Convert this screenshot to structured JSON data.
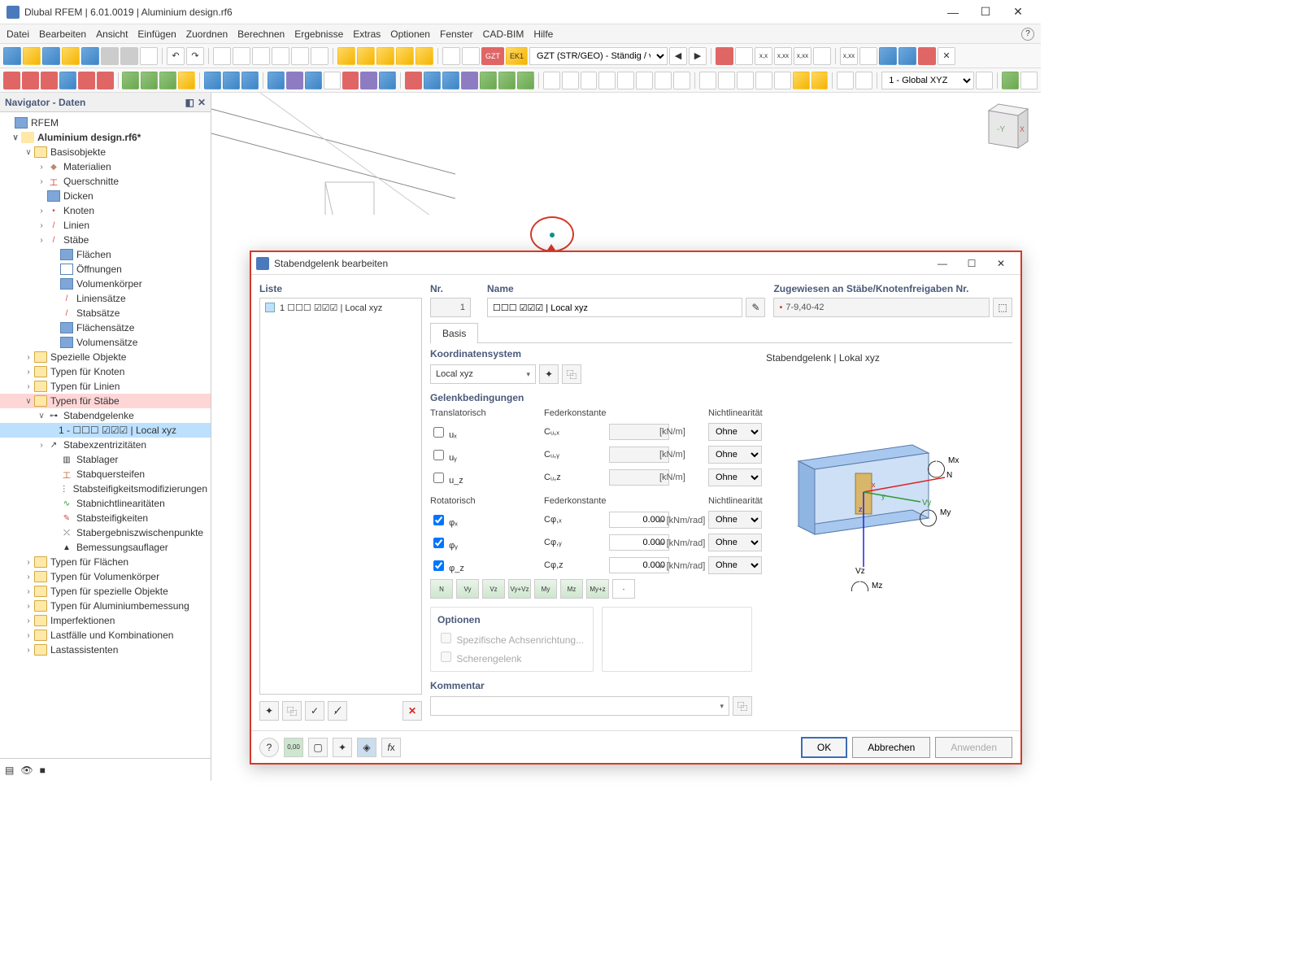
{
  "window": {
    "title": "Dlubal RFEM | 6.01.0019 | Aluminium design.rf6"
  },
  "menu": {
    "datei": "Datei",
    "bearbeiten": "Bearbeiten",
    "ansicht": "Ansicht",
    "einfuegen": "Einfügen",
    "zuordnen": "Zuordnen",
    "berechnen": "Berechnen",
    "ergebnisse": "Ergebnisse",
    "extras": "Extras",
    "optionen": "Optionen",
    "fenster": "Fenster",
    "cadbim": "CAD-BIM",
    "hilfe": "Hilfe"
  },
  "toolbar": {
    "gzt": "GZT",
    "ek1": "EK1",
    "combo": "GZT (STR/GEO) - Ständig / v...",
    "coord": "1 - Global XYZ"
  },
  "navigator": {
    "title": "Navigator - Daten",
    "root": "RFEM",
    "file": "Aluminium design.rf6*",
    "basis": "Basisobjekte",
    "items": {
      "materialien": "Materialien",
      "querschnitte": "Querschnitte",
      "dicken": "Dicken",
      "knoten": "Knoten",
      "linien": "Linien",
      "staebe": "Stäbe",
      "flaechen": "Flächen",
      "oeffnungen": "Öffnungen",
      "volumen": "Volumenkörper",
      "liniensaetze": "Liniensätze",
      "stabsaetze": "Stabsätze",
      "flaechensaetze": "Flächensätze",
      "volumensaetze": "Volumensätze"
    },
    "groups": {
      "spezielle": "Spezielle Objekte",
      "typKnoten": "Typen für Knoten",
      "typLinien": "Typen für Linien",
      "typStaebe": "Typen für Stäbe",
      "stabendgelenke": "Stabendgelenke",
      "item1": "1 - ☐☐☐ ☑☑☑ | Local xyz",
      "stabexz": "Stabexzentrizitäten",
      "stablager": "Stablager",
      "stabquer": "Stabquersteifen",
      "stabsteifmod": "Stabsteifigkeitsmodifizierungen",
      "stabnicht": "Stabnichtlinearitäten",
      "stabsteif": "Stabsteifigkeiten",
      "staberg": "Stabergebniszwischenpunkte",
      "bemessung": "Bemessungsauflager",
      "typFlaechen": "Typen für Flächen",
      "typVolumen": "Typen für Volumenkörper",
      "typSpez": "Typen für spezielle Objekte",
      "typAlu": "Typen für Aluminiumbemessung",
      "imperf": "Imperfektionen",
      "lastfaelle": "Lastfälle und Kombinationen",
      "lastass": "Lastassistenten"
    }
  },
  "dialog": {
    "title": "Stabendgelenk bearbeiten",
    "liste": "Liste",
    "listItem": "1 ☐☐☐ ☑☑☑ | Local xyz",
    "nr": "Nr.",
    "nrVal": "1",
    "name": "Name",
    "nameVal": "☐☐☐ ☑☑☑ | Local xyz",
    "zugewiesen": "Zugewiesen an Stäbe/Knotenfreigaben Nr.",
    "zugVal": "7-9,40-42",
    "basis": "Basis",
    "koord": "Koordinatensystem",
    "koordVal": "Local xyz",
    "gelenk": "Gelenkbedingungen",
    "trans": "Translatorisch",
    "feder": "Federkonstante",
    "nicht": "Nichtlinearität",
    "rot": "Rotatorisch",
    "ux": "uₓ",
    "uy": "uᵧ",
    "uz": "u_z",
    "cux": "Cᵤ,ₓ",
    "cuy": "Cᵤ,ᵧ",
    "cuz": "Cᵤ,z",
    "phix": "φₓ",
    "phiy": "φᵧ",
    "phiz": "φ_z",
    "cphix": "Cφ,ₓ",
    "cphiy": "Cφ,ᵧ",
    "cphiz": "Cφ,z",
    "knm": "[kN/m]",
    "knmrad": "[kNm/rad]",
    "val0": "0.000",
    "ohne": "Ohne",
    "optionen": "Optionen",
    "spezAchse": "Spezifische Achsenrichtung...",
    "scheren": "Scherengelenk",
    "kommentar": "Kommentar",
    "preview": "Stabendgelenk | Lokal xyz",
    "ok": "OK",
    "abbrechen": "Abbrechen",
    "anwenden": "Anwenden",
    "presets": {
      "n": "N",
      "vy": "Vy",
      "vz": "Vz",
      "vyvz": "Vy+Vz",
      "my": "My",
      "mz": "Mz",
      "mymz": "My+z",
      "clear": "-"
    }
  }
}
